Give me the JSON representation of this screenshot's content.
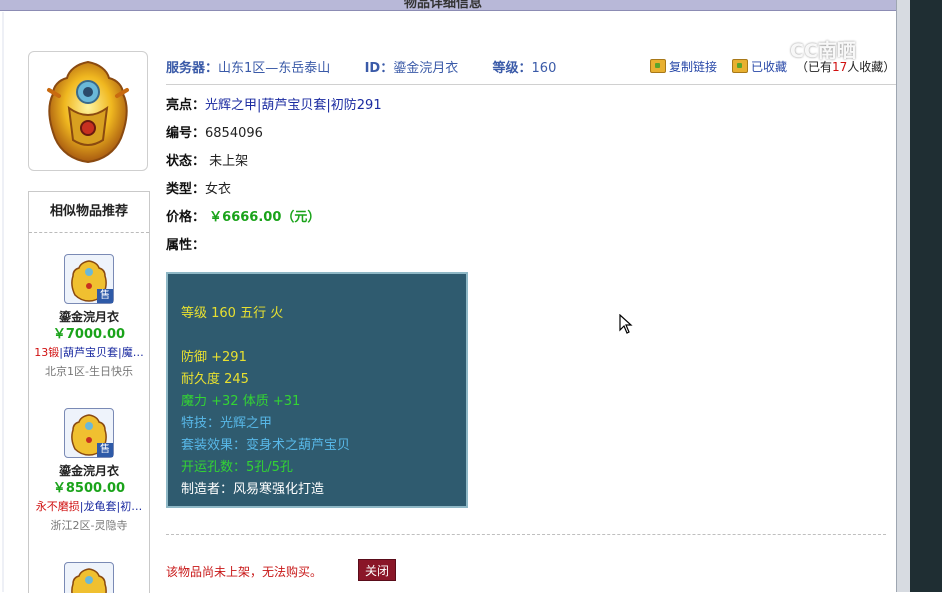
{
  "window": {
    "title": "物品详细信息"
  },
  "watermark": "CC南晒",
  "left": {
    "similar_title": "相似物品推荐",
    "items": [
      {
        "name": "鎏金浣月衣",
        "price": "￥7000.00",
        "badge": "售",
        "tag_red": "13锻",
        "tag_blue": "|葫芦宝贝套|魔…",
        "server": "北京1区-生日快乐"
      },
      {
        "name": "鎏金浣月衣",
        "price": "￥8500.00",
        "badge": "售",
        "tag_red": "永不磨损",
        "tag_blue": "|龙龟套|初…",
        "server": "浙江2区-灵隐寺"
      }
    ]
  },
  "info": {
    "server_label": "服务器：",
    "server_value": "山东1区—东岳泰山",
    "id_label": "ID：",
    "id_value": "鎏金浣月衣",
    "level_label": "等级：",
    "level_value": "160",
    "copy_link": "复制链接",
    "favorited": "已收藏",
    "fav_prefix": "（已有",
    "fav_count": "17",
    "fav_suffix": "人收藏）"
  },
  "fields": {
    "highlight_label": "亮点：",
    "highlight_value": "光辉之甲|葫芦宝贝套|初防291",
    "serial_label": "编号：",
    "serial_value": "6854096",
    "status_label": "状态：",
    "status_value": "未上架",
    "type_label": "类型：",
    "type_value": "女衣",
    "price_label": "价格：",
    "price_value": "￥6666.00（元）",
    "attr_label": "属性："
  },
  "attributes": {
    "level_element": "等级 160  五行 火",
    "defense": "防御 +291",
    "durability": "耐久度 245",
    "magic_stats": "魔力 +32  体质 +31",
    "skill": "特技：光辉之甲",
    "set_effect": "套装效果：变身术之葫芦宝贝",
    "slots": "开运孔数：5孔/5孔",
    "maker": "制造者：风易寒强化打造"
  },
  "footer": {
    "notice": "该物品尚未上架，无法购买。",
    "close_label": "关闭"
  }
}
